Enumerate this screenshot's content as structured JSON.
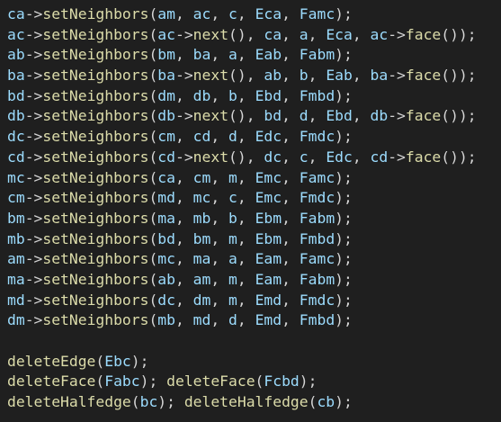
{
  "colors": {
    "background": "#1f1f1f",
    "function": "#dcdcaa",
    "identifier": "#9cdcfe",
    "punctuation": "#d4d4d4"
  },
  "code_lines": [
    "ca->setNeighbors(am, ac, c, Eca, Famc);",
    "ac->setNeighbors(ac->next(), ca, a, Eca, ac->face());",
    "ab->setNeighbors(bm, ba, a, Eab, Fabm);",
    "ba->setNeighbors(ba->next(), ab, b, Eab, ba->face());",
    "bd->setNeighbors(dm, db, b, Ebd, Fmbd);",
    "db->setNeighbors(db->next(), bd, d, Ebd, db->face());",
    "dc->setNeighbors(cm, cd, d, Edc, Fmdc);",
    "cd->setNeighbors(cd->next(), dc, c, Edc, cd->face());",
    "mc->setNeighbors(ca, cm, m, Emc, Famc);",
    "cm->setNeighbors(md, mc, c, Emc, Fmdc);",
    "bm->setNeighbors(ma, mb, b, Ebm, Fabm);",
    "mb->setNeighbors(bd, bm, m, Ebm, Fmbd);",
    "am->setNeighbors(mc, ma, a, Eam, Famc);",
    "ma->setNeighbors(ab, am, m, Eam, Fabm);",
    "md->setNeighbors(dc, dm, m, Emd, Fmdc);",
    "dm->setNeighbors(mb, md, d, Emd, Fmbd);",
    "",
    "deleteEdge(Ebc);",
    "deleteFace(Fabc); deleteFace(Fcbd);",
    "deleteHalfedge(bc); deleteHalfedge(cb);"
  ]
}
